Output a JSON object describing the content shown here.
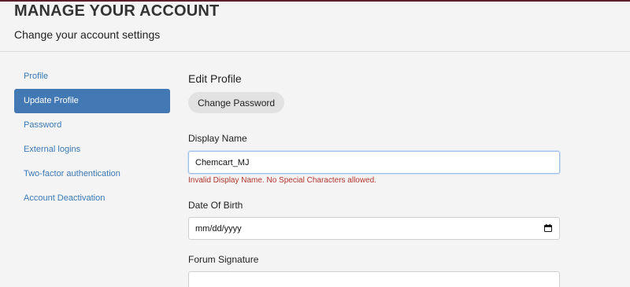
{
  "header": {
    "title": "MANAGE YOUR ACCOUNT",
    "subtitle": "Change your account settings"
  },
  "sidebar": {
    "items": [
      {
        "label": "Profile",
        "active": false
      },
      {
        "label": "Update Profile",
        "active": true
      },
      {
        "label": "Password",
        "active": false
      },
      {
        "label": "External logins",
        "active": false
      },
      {
        "label": "Two-factor authentication",
        "active": false
      },
      {
        "label": "Account Deactivation",
        "active": false
      }
    ]
  },
  "main": {
    "section_title": "Edit Profile",
    "change_password_label": "Change Password",
    "display_name": {
      "label": "Display Name",
      "value": "Chemcart_MJ",
      "error": "Invalid Display Name. No Special Characters allowed."
    },
    "date_of_birth": {
      "label": "Date Of Birth",
      "placeholder": "mm/dd/yyyy"
    },
    "forum_signature": {
      "label": "Forum Signature"
    }
  },
  "colors": {
    "accent": "#4279b4",
    "link": "#3a79b6",
    "error": "#b3352d",
    "top_bar": "#5a1f2a"
  },
  "icons": {
    "date_picker": "calendar-icon"
  }
}
